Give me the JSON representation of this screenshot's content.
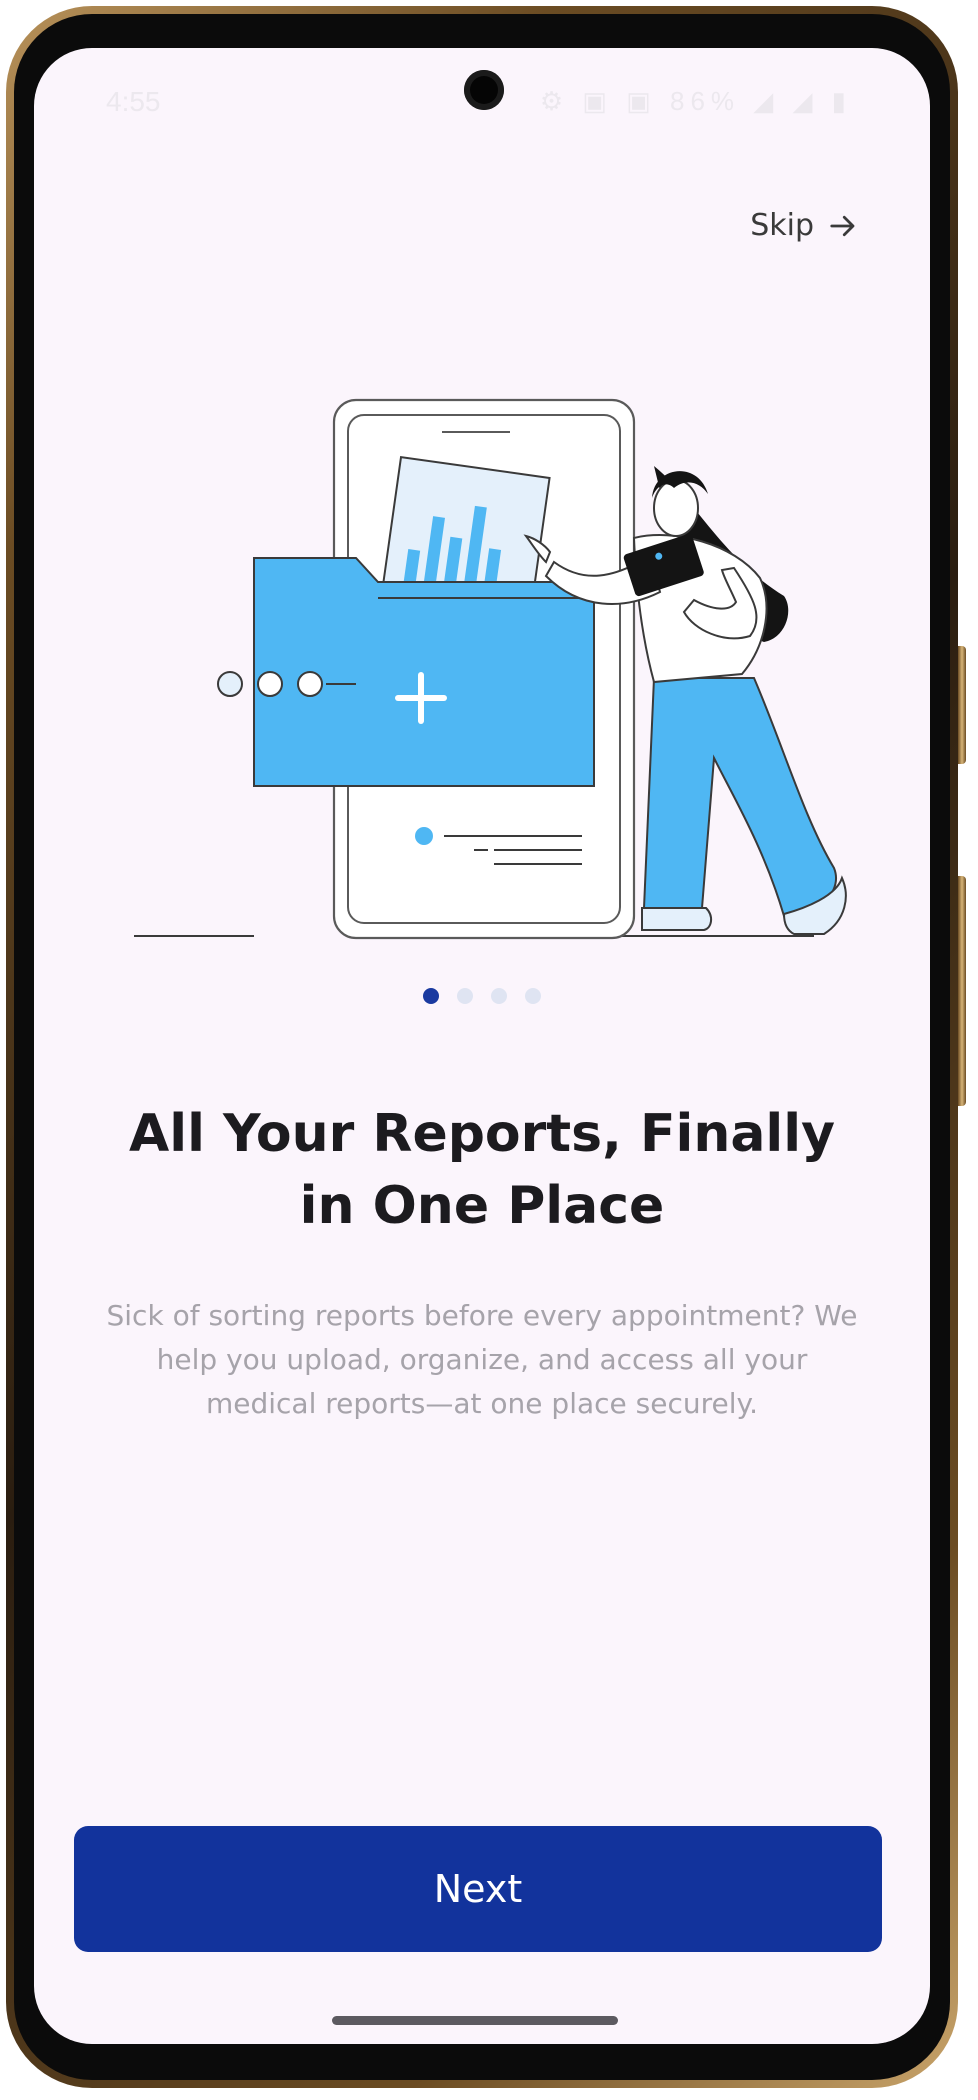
{
  "status_bar": {
    "time": "4:55",
    "icons": "⚙ ▣ ▣ 86% ◢ ◢ ▮"
  },
  "onboarding": {
    "skip_label": "Skip",
    "headline": "All Your Reports, Finally in One Place",
    "description": "Sick of sorting reports before every appointment? We help you upload, organize, and access all your medical reports—at one place securely.",
    "page_indicator": {
      "total": 4,
      "active": 1
    },
    "next_label": "Next"
  },
  "colors": {
    "background": "#fbf5fc",
    "primary": "#12339c",
    "accent_blue": "#4fb7f3",
    "dot_inactive": "#dfe4f2",
    "text_dark": "#1c1b1f",
    "text_muted": "#a6a3aa"
  },
  "icons": {
    "skip": "arrow-right-icon",
    "camera": "front-camera"
  }
}
